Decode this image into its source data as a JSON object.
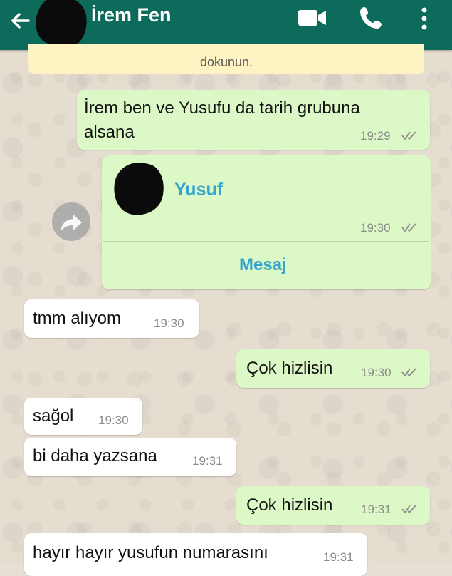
{
  "header": {
    "title": "İrem Fen",
    "bg_color": "#0c6b5b",
    "icons": [
      "back-arrow-icon",
      "video-call-icon",
      "phone-icon",
      "more-options-icon"
    ]
  },
  "banner": {
    "text": "dokunun."
  },
  "messages": [
    {
      "dir": "out",
      "line1": "İrem ben ve Yusufu da tarih grubuna",
      "line2": "alsana",
      "time": "19:29"
    },
    {
      "dir": "out",
      "type": "contact",
      "name": "Yusuf",
      "time": "19:30",
      "action": "Mesaj"
    },
    {
      "dir": "in",
      "text": "tmm alıyom",
      "time": "19:30"
    },
    {
      "dir": "out",
      "text": "Çok hizlisin",
      "time": "19:30"
    },
    {
      "dir": "in",
      "text": "sağol",
      "time": "19:30"
    },
    {
      "dir": "in",
      "text": "bi daha yazsana",
      "time": "19:31"
    },
    {
      "dir": "out",
      "text": "Çok hizlisin",
      "time": "19:31"
    },
    {
      "dir": "in",
      "text": "hayır hayır yusufun numarasını",
      "time": "19:31"
    }
  ],
  "colors": {
    "outgoing_bubble": "#dcf8c6",
    "incoming_bubble": "#ffffff",
    "link": "#34a5cf"
  }
}
